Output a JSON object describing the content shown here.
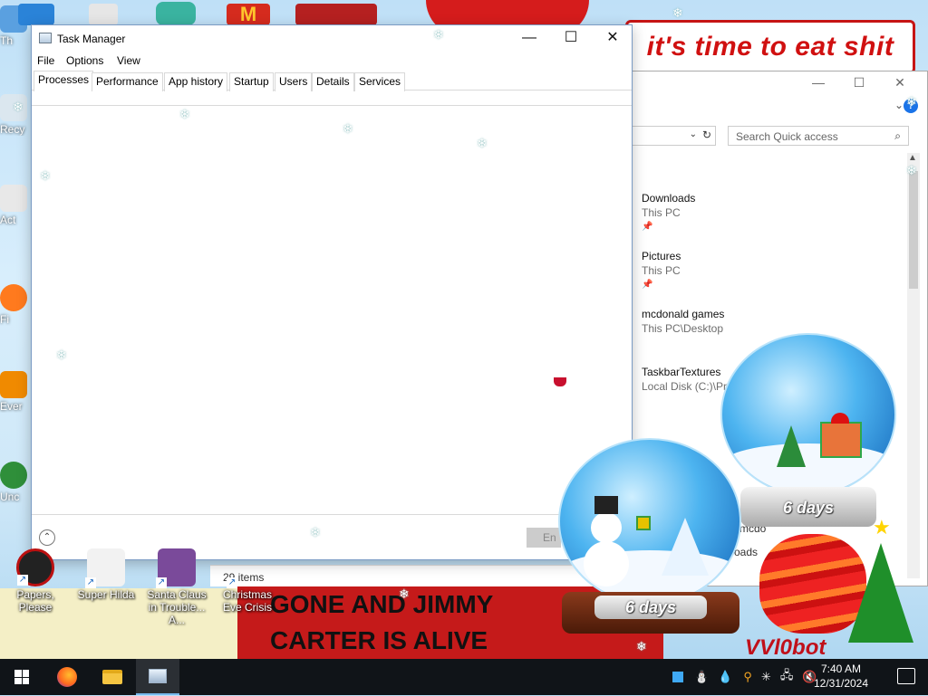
{
  "desktop": {
    "banner_top": "it's time to eat shit",
    "banner_bottom_line1": "GONE AND JIMMY",
    "banner_bottom_line2": "CARTER IS ALIVE",
    "signature": "VVl0bot",
    "left_icons": [
      "Th",
      "Recy",
      "Act",
      "Fi",
      "Ever",
      "Unc"
    ],
    "icons": [
      {
        "label": "Papers, Please"
      },
      {
        "label": "Super Hilda"
      },
      {
        "label": "Santa Claus in Trouble... A..."
      },
      {
        "label": "Christmas Eve Crisis"
      }
    ],
    "snow_globes": [
      {
        "caption": "6 days"
      },
      {
        "caption": "6 days"
      }
    ]
  },
  "explorer": {
    "search_placeholder": "Search Quick access",
    "quick_access": [
      {
        "name": "Downloads",
        "location": "This PC"
      },
      {
        "name": "Pictures",
        "location": "This PC"
      },
      {
        "name": "mcdonald games",
        "location": "This PC\\Desktop"
      },
      {
        "name": "TaskbarTextures",
        "location": "Local Disk (C:)\\Pr..."
      }
    ],
    "fragment_1": "mcdo",
    "fragment_2": "oads",
    "status": "29 items"
  },
  "task_manager": {
    "title": "Task Manager",
    "menu": [
      "File",
      "Options",
      "View"
    ],
    "tabs": [
      "Processes",
      "Performance",
      "App history",
      "Startup",
      "Users",
      "Details",
      "Services"
    ],
    "active_tab": "Processes",
    "end_task_label": "En"
  },
  "taskbar": {
    "time": "7:40 AM",
    "date": "12/31/2024"
  },
  "colors": {
    "banner_red": "#c51a1a",
    "taskbar": "#101418",
    "accent": "#76b9ed"
  }
}
